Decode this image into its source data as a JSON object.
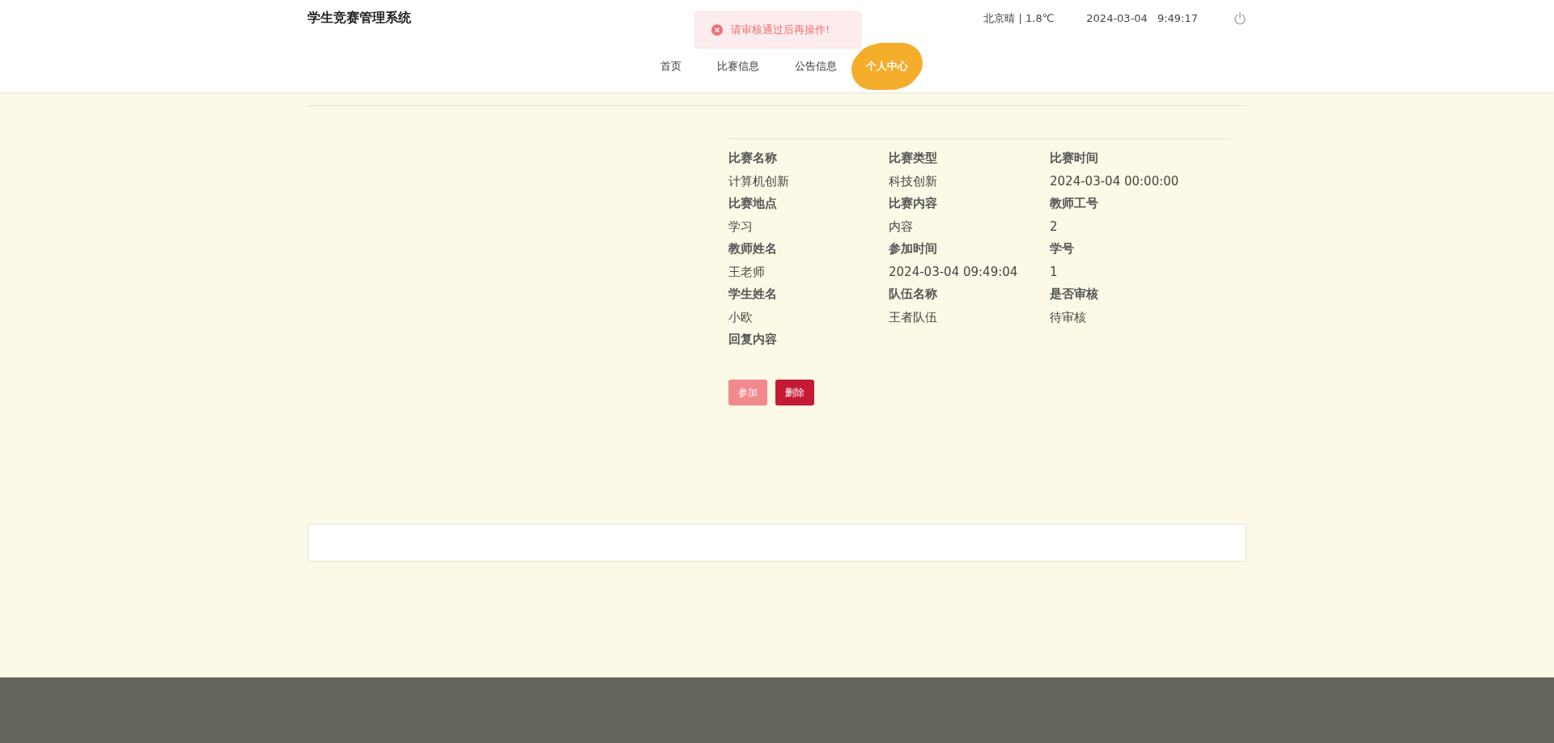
{
  "header": {
    "title": "学生竞赛管理系统",
    "weather": "北京晴 | 1.8℃",
    "date": "2024-03-04",
    "time": "9:49:17"
  },
  "toast": {
    "kind": "error",
    "message": "请审核通过后再操作!"
  },
  "nav": [
    {
      "label": "首页",
      "selected": false
    },
    {
      "label": "比赛信息",
      "selected": false
    },
    {
      "label": "公告信息",
      "selected": false
    },
    {
      "label": "个人中心",
      "selected": true
    }
  ],
  "details": [
    {
      "label": "比赛名称",
      "value": "计算机创新"
    },
    {
      "label": "比赛类型",
      "value": "科技创新"
    },
    {
      "label": "比赛时间",
      "value": "2024-03-04 00:00:00"
    },
    {
      "label": "比赛地点",
      "value": "学习"
    },
    {
      "label": "比赛内容",
      "value": "内容"
    },
    {
      "label": "教师工号",
      "value": "2"
    },
    {
      "label": "教师姓名",
      "value": "王老师"
    },
    {
      "label": "参加时间",
      "value": "2024-03-04 09:49:04"
    },
    {
      "label": "学号",
      "value": "1"
    },
    {
      "label": "学生姓名",
      "value": "小欧"
    },
    {
      "label": "队伍名称",
      "value": "王者队伍"
    },
    {
      "label": "是否审核",
      "value": "待审核"
    },
    {
      "label": "回复内容"
    }
  ],
  "buttons": [
    {
      "label": "参加",
      "kind": "light"
    },
    {
      "label": "删除",
      "kind": "danger"
    }
  ]
}
